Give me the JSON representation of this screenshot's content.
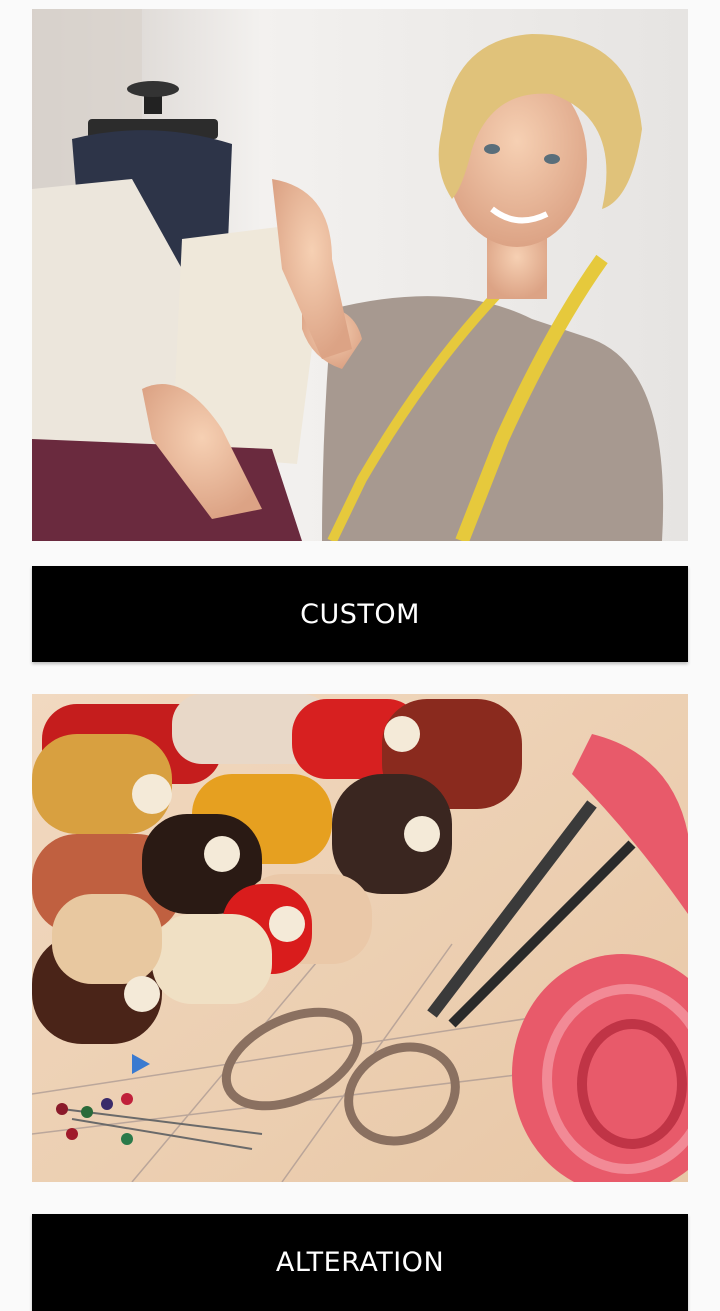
{
  "cards": [
    {
      "image_alt": "Tailor woman pinning fabric on dress form",
      "button_label": "CUSTOM"
    },
    {
      "image_alt": "Thread spools, scissors and measuring tape",
      "button_label": "ALTERATION"
    }
  ],
  "colors": {
    "background": "#fafafa",
    "button_bg": "#000000",
    "button_text": "#ffffff"
  }
}
